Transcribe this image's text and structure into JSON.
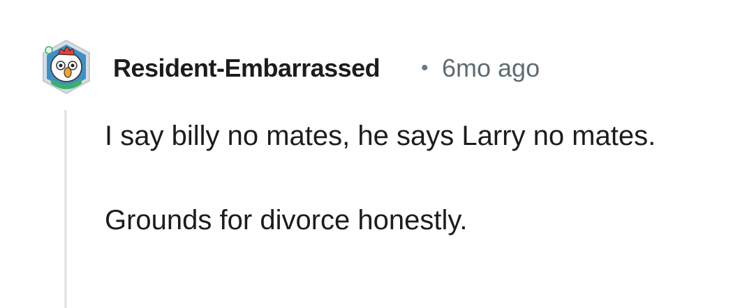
{
  "comment": {
    "author": "Resident-Embarrassed",
    "separator": "•",
    "time_ago": "6mo ago",
    "avatar_icon": "chicken-avatar-icon",
    "paragraphs": [
      "I say billy no mates, he says Larry no mates.",
      "Grounds for divorce honestly."
    ]
  },
  "colors": {
    "text": "#1c1c1c",
    "meta": "#5f6b73",
    "thread_line": "#e4e6e8",
    "avatar_bg": "#3f8fc7"
  }
}
